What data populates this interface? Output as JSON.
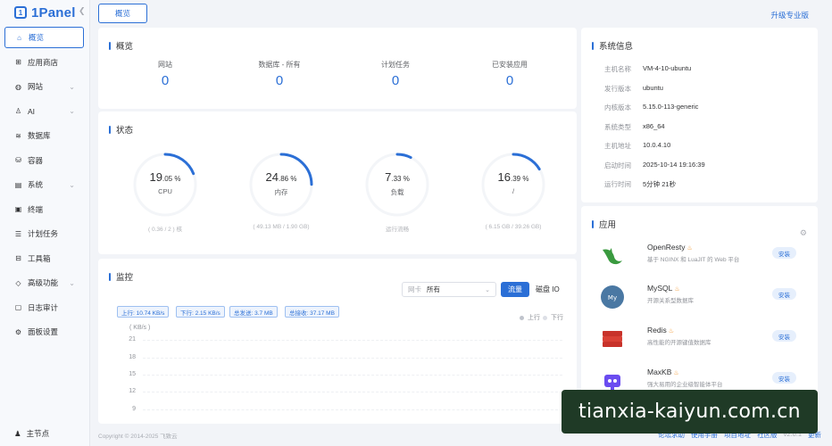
{
  "brand": {
    "name": "1Panel",
    "mark": "1"
  },
  "sidebar": {
    "items": [
      {
        "label": "概览",
        "icon": "home-icon",
        "glyph": "⌂",
        "active": true,
        "arrow": false
      },
      {
        "label": "应用商店",
        "icon": "app-store-icon",
        "glyph": "⊞",
        "active": false,
        "arrow": false
      },
      {
        "label": "网站",
        "icon": "globe-icon",
        "glyph": "◍",
        "active": false,
        "arrow": true
      },
      {
        "label": "AI",
        "icon": "robot-icon",
        "glyph": "♙",
        "active": false,
        "arrow": true
      },
      {
        "label": "数据库",
        "icon": "database-icon",
        "glyph": "≋",
        "active": false,
        "arrow": false
      },
      {
        "label": "容器",
        "icon": "container-icon",
        "glyph": "⛁",
        "active": false,
        "arrow": false
      },
      {
        "label": "系统",
        "icon": "system-icon",
        "glyph": "▤",
        "active": false,
        "arrow": true
      },
      {
        "label": "终端",
        "icon": "terminal-icon",
        "glyph": "▣",
        "active": false,
        "arrow": false
      },
      {
        "label": "计划任务",
        "icon": "task-icon",
        "glyph": "☰",
        "active": false,
        "arrow": false
      },
      {
        "label": "工具箱",
        "icon": "toolbox-icon",
        "glyph": "⊟",
        "active": false,
        "arrow": false
      },
      {
        "label": "高级功能",
        "icon": "diamond-icon",
        "glyph": "◇",
        "active": false,
        "arrow": true
      },
      {
        "label": "日志审计",
        "icon": "log-icon",
        "glyph": "▢",
        "active": false,
        "arrow": false
      },
      {
        "label": "面板设置",
        "icon": "settings-icon",
        "glyph": "⚙",
        "active": false,
        "arrow": false
      }
    ],
    "footer": {
      "label": "主节点"
    }
  },
  "topbar": {
    "tab": "概览",
    "upgrade": "升级专业版"
  },
  "overview": {
    "title": "概览",
    "stats": [
      {
        "label": "网站",
        "value": "0"
      },
      {
        "label": "数据库 - 所有",
        "value": "0"
      },
      {
        "label": "计划任务",
        "value": "0"
      },
      {
        "label": "已安装应用",
        "value": "0"
      }
    ]
  },
  "status": {
    "title": "状态",
    "gauges": [
      {
        "int": "19",
        "dec": ".05",
        "unit": "%",
        "percent": 19.05,
        "label": "CPU",
        "detail": "( 0.36 / 2 ) 核"
      },
      {
        "int": "24",
        "dec": ".86",
        "unit": "%",
        "percent": 24.86,
        "label": "内存",
        "detail": "( 49.13 MB / 1.90 GB)"
      },
      {
        "int": "7",
        "dec": ".33",
        "unit": "%",
        "percent": 7.33,
        "label": "负载",
        "detail": "运行流畅"
      },
      {
        "int": "16",
        "dec": ".39",
        "unit": "%",
        "percent": 16.39,
        "label": "/",
        "detail": "( 6.15 GB / 39.26 GB)"
      }
    ]
  },
  "monitor": {
    "title": "监控",
    "select_prefix": "网卡",
    "select_value": "所有",
    "btn_flow": "流量",
    "btn_io": "磁盘 IO",
    "chips": [
      "上行: 10.74 KB/s",
      "下行: 2.15 KB/s",
      "总发送: 3.7 MB",
      "总接收: 37.17 MB"
    ],
    "legend": {
      "up": "上行",
      "down": "下行"
    },
    "unit": "( KB/s )",
    "yticks": [
      "21",
      "18",
      "15",
      "12",
      "9"
    ]
  },
  "sysinfo": {
    "title": "系统信息",
    "rows": [
      {
        "key": "主机名称",
        "value": "VM-4-10-ubuntu"
      },
      {
        "key": "发行版本",
        "value": "ubuntu"
      },
      {
        "key": "内核版本",
        "value": "5.15.0-113-generic"
      },
      {
        "key": "系统类型",
        "value": "x86_64"
      },
      {
        "key": "主机地址",
        "value": "10.0.4.10"
      },
      {
        "key": "启动时间",
        "value": "2025-10-14 19:16:39"
      },
      {
        "key": "运行时间",
        "value": "5分钟 21秒"
      }
    ]
  },
  "apps": {
    "title": "应用",
    "items": [
      {
        "name": "OpenResty",
        "desc": "基于 NGINX 和 LuaJIT 的 Web 平台",
        "action": "安装",
        "icon": "openresty-logo"
      },
      {
        "name": "MySQL",
        "desc": "开源关系型数据库",
        "action": "安装",
        "icon": "mysql-logo"
      },
      {
        "name": "Redis",
        "desc": "高性能的开源键值数据库",
        "action": "安装",
        "icon": "redis-logo"
      },
      {
        "name": "MaxKB",
        "desc": "强大易用的企业级智能体平台",
        "action": "安装",
        "icon": "maxkb-logo"
      }
    ]
  },
  "footer": {
    "copyright": "Copyright © 2014-2025 飞致云",
    "links": [
      "论坛求助",
      "使用手册",
      "项目地址",
      "社区版"
    ],
    "version": "v2.0.1",
    "update": "更新"
  },
  "watermark": "tianxia-kaiyun.com.cn",
  "colors": {
    "accent": "#2b6fd6",
    "hot": "#f29b38"
  }
}
